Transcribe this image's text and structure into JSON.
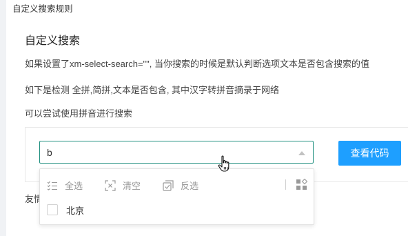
{
  "page": {
    "top_heading": "自定义搜索规则"
  },
  "section": {
    "title": "自定义搜索",
    "line1": "如果设置了xm-select-search=\"\", 当你搜索的时候是默认判断选项文本是否包含搜索的值",
    "line2": "如下是检测 全拼,简拼,文本是否包含, 其中汉字转拼音摘录于网络",
    "line3": "可以尝试使用拼音进行搜索"
  },
  "select": {
    "value": "b"
  },
  "code_button": {
    "label": "查看代码"
  },
  "dropdown": {
    "toolbar": {
      "select_all": "全选",
      "clear": "清空",
      "invert": "反选"
    },
    "options": [
      {
        "label": "北京",
        "checked": false
      }
    ]
  },
  "footer": {
    "partial_text": "友情"
  },
  "colors": {
    "accent_border": "#1f8f7f",
    "button_blue": "#1e9fff",
    "muted_text": "#999999"
  },
  "icons": {
    "select_all": "list-check-icon",
    "clear": "clear-icon",
    "invert": "invert-check-icon",
    "more": "grid-icon",
    "dropdown_arrow": "caret-up-icon",
    "cursor": "hand-pointer-icon"
  }
}
